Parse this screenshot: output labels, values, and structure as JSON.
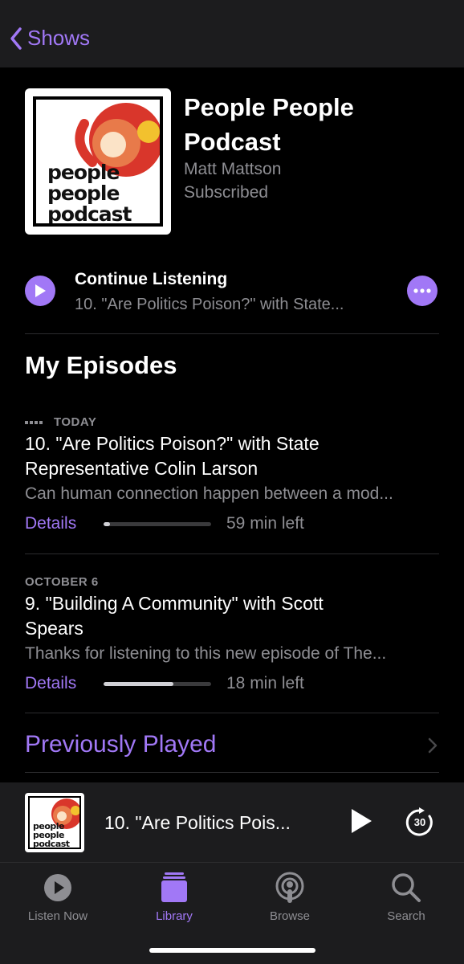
{
  "nav": {
    "back_label": "Shows"
  },
  "show": {
    "title": "People People Podcast",
    "author": "Matt Mattson",
    "status": "Subscribed",
    "art_words": [
      "people",
      "people",
      "podcast"
    ]
  },
  "continue": {
    "title": "Continue Listening",
    "subtitle": "10. \"Are Politics Poison?\" with State..."
  },
  "section_title": "My Episodes",
  "episodes": [
    {
      "date": "TODAY",
      "title": "10. \"Are Politics Poison?\" with State Representative Colin Larson",
      "description": "Can human connection happen between a mod...",
      "details_label": "Details",
      "progress": 0.06,
      "time_left": "59 min left"
    },
    {
      "date": "OCTOBER 6",
      "title": "9. \"Building A Community\" with Scott Spears",
      "description": "Thanks for listening to this new episode of The...",
      "details_label": "Details",
      "progress": 0.65,
      "time_left": "18 min left"
    }
  ],
  "previously_played": "Previously Played",
  "mini_player": {
    "title": "10. \"Are Politics Pois...",
    "skip_seconds": "30"
  },
  "tabs": [
    {
      "label": "Listen Now",
      "icon": "play-circle-icon"
    },
    {
      "label": "Library",
      "icon": "library-icon"
    },
    {
      "label": "Browse",
      "icon": "podcast-icon"
    },
    {
      "label": "Search",
      "icon": "search-icon"
    }
  ],
  "colors": {
    "accent": "#a178f6",
    "background": "#000000",
    "bar": "#1c1c1e",
    "secondary_text": "#8e8e93"
  }
}
